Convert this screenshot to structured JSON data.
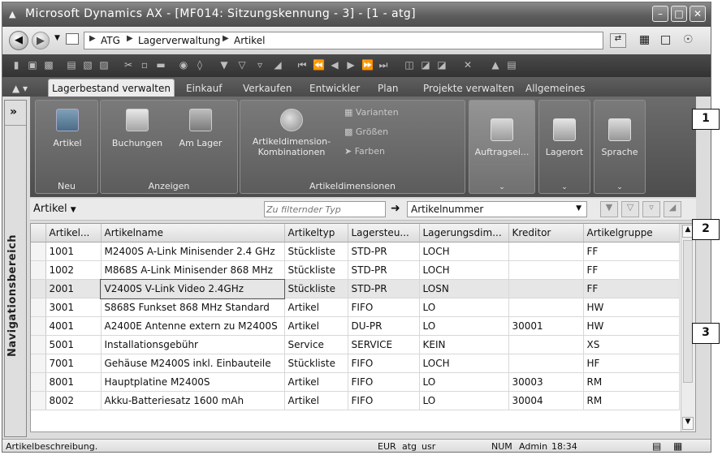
{
  "window": {
    "title": "Microsoft Dynamics AX - [MF014: Sitzungskennung - 3] - [1 - atg]"
  },
  "address": {
    "crumbs": [
      "ATG",
      "Lagerverwaltung",
      "Artikel"
    ]
  },
  "tabs": [
    "Lagerbestand verwalten",
    "Einkauf",
    "Verkaufen",
    "Entwickler",
    "Plan",
    "Projekte verwalten",
    "Allgemeines"
  ],
  "nav_panel": {
    "expand": "»",
    "label": "Navigationsbereich"
  },
  "ribbon": {
    "groups": {
      "neu": {
        "label": "Neu",
        "buttons": [
          "Artikel"
        ]
      },
      "anzeigen": {
        "label": "Anzeigen",
        "buttons": [
          "Buchungen",
          "Am Lager"
        ]
      },
      "dimensionen": {
        "label": "Artikeldimensionen",
        "main_line1": "Artikeldimension-",
        "main_line2": "Kombinationen",
        "small": [
          "Varianten",
          "Größen",
          "Farben"
        ]
      },
      "auftrag": {
        "label": "Auftragsei..."
      },
      "lagerort": {
        "label": "Lagerort"
      },
      "sprache": {
        "label": "Sprache"
      }
    }
  },
  "filter": {
    "table_label": "Artikel",
    "placeholder": "Zu filternder Typ",
    "field": "Artikelnummer"
  },
  "grid": {
    "columns": [
      "Artikel...",
      "Artikelname",
      "Artikeltyp",
      "Lagersteu...",
      "Lagerungsdim...",
      "Kreditor",
      "Artikelgruppe"
    ],
    "rows": [
      [
        "1001",
        "M2400S A-Link Minisender 2.4 GHz",
        "Stückliste",
        "STD-PR",
        "LOCH",
        "",
        "FF"
      ],
      [
        "1002",
        "M868S A-Link Minisender 868 MHz",
        "Stückliste",
        "STD-PR",
        "LOCH",
        "",
        "FF"
      ],
      [
        "2001",
        "V2400S V-Link Video 2.4GHz",
        "Stückliste",
        "STD-PR",
        "LOSN",
        "",
        "FF"
      ],
      [
        "3001",
        "S868S Funkset 868 MHz Standard",
        "Artikel",
        "FIFO",
        "LO",
        "",
        "HW"
      ],
      [
        "4001",
        "A2400E Antenne extern zu M2400S",
        "Artikel",
        "DU-PR",
        "LO",
        "30001",
        "HW"
      ],
      [
        "5001",
        "Installationsgebühr",
        "Service",
        "SERVICE",
        "KEIN",
        "",
        "XS"
      ],
      [
        "7001",
        "Gehäuse M2400S inkl. Einbauteile",
        "Stückliste",
        "FIFO",
        "LOCH",
        "",
        "HF"
      ],
      [
        "8001",
        "Hauptplatine M2400S",
        "Artikel",
        "FIFO",
        "LO",
        "30003",
        "RM"
      ],
      [
        "8002",
        "Akku-Batteriesatz 1600 mAh",
        "Artikel",
        "FIFO",
        "LO",
        "30004",
        "RM"
      ]
    ]
  },
  "status": {
    "text": "Artikelbeschreibung.",
    "currency": "EUR",
    "company": "atg",
    "layer": "usr",
    "num": "NUM",
    "user": "Admin",
    "time": "18:34"
  },
  "callouts": [
    "1",
    "2",
    "3"
  ]
}
